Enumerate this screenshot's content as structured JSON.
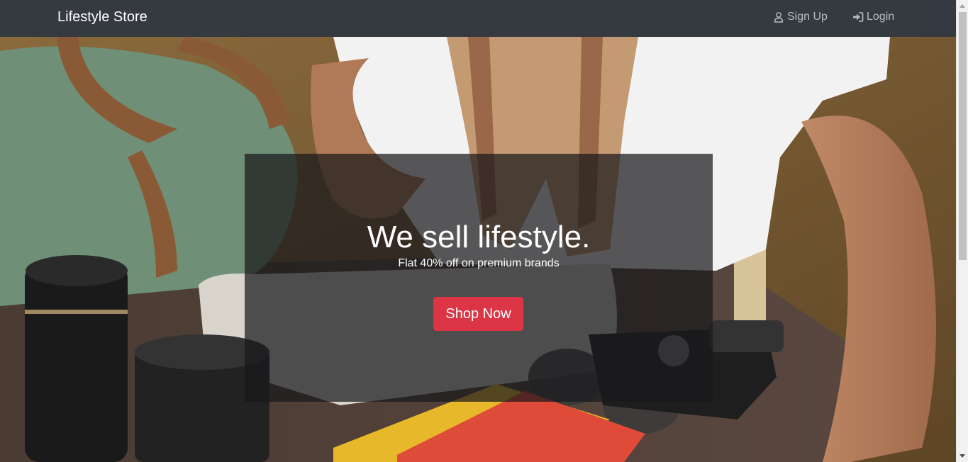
{
  "navbar": {
    "brand": "Lifestyle Store",
    "links": [
      {
        "label": "Sign Up",
        "icon": "user-icon"
      },
      {
        "label": "Login",
        "icon": "sign-in-icon"
      }
    ]
  },
  "hero": {
    "title": "We sell lifestyle.",
    "subtitle": "Flat 40% off on premium brands",
    "button_label": "Shop Now"
  },
  "colors": {
    "navbar_bg": "#343a40",
    "button_bg": "#dc3545",
    "nav_link": "#b8bcc0"
  }
}
